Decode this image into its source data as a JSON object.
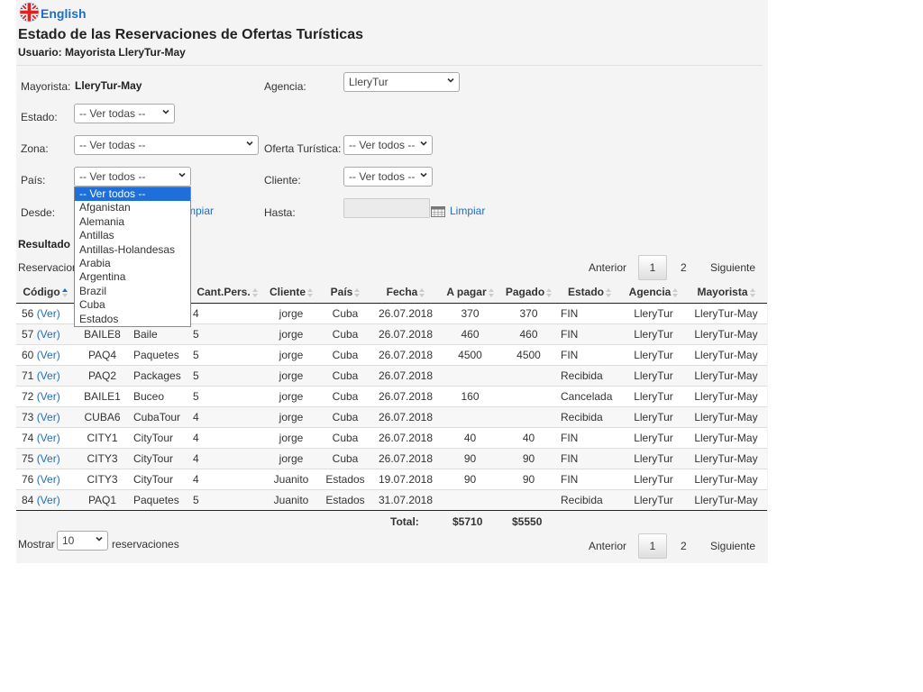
{
  "language": {
    "label": "English",
    "icon": "uk-flag-icon"
  },
  "header": {
    "title": "Estado de las Reservaciones de Ofertas Turísticas",
    "user": "Usuario: Mayorista LleryTur-May"
  },
  "filters": {
    "mayorista_label": "Mayorista:",
    "mayorista_value": "LleryTur-May",
    "agencia_label": "Agencia:",
    "agencia_value": "LleryTur",
    "estado_label": "Estado:",
    "estado_value": "-- Ver todas --",
    "zona_label": "Zona:",
    "zona_value": "-- Ver todas --",
    "oferta_label": "Oferta Turística:",
    "oferta_value": "-- Ver todos --",
    "pais_label": "País:",
    "pais_value": "-- Ver todos --",
    "cliente_label": "Cliente:",
    "cliente_value": "-- Ver todos --",
    "desde_label": "Desde:",
    "hasta_label": "Hasta:",
    "limpiar_label": "Limpiar",
    "limpiar_partial": "mpiar"
  },
  "pais_dropdown": {
    "options": [
      "-- Ver todos --",
      "Afganistan",
      "Alemania",
      "Antillas",
      "Antillas-Holandesas",
      "Arabia",
      "Argentina",
      "Brazil",
      "Cuba",
      "Estados"
    ],
    "selected_index": 0
  },
  "results": {
    "title": "Resultado",
    "subtitle": "Reservacion",
    "columns": [
      "Código",
      "",
      "",
      "Cant.Pers.",
      "Cliente",
      "País",
      "Fecha",
      "A pagar",
      "Pagado",
      "Estado",
      "Agencia",
      "Mayorista"
    ],
    "ver_label": "(Ver)",
    "rows": [
      {
        "codigo": "56",
        "code": "",
        "tipo": "",
        "cant": "4",
        "cliente": "jorge",
        "pais": "Cuba",
        "fecha": "26.07.2018",
        "apagar": "370",
        "pagado": "370",
        "estado": "FIN",
        "agencia": "LleryTur",
        "mayorista": "LleryTur-May"
      },
      {
        "codigo": "57",
        "code": "BAILE8",
        "tipo": "Baile",
        "cant": "5",
        "cliente": "jorge",
        "pais": "Cuba",
        "fecha": "26.07.2018",
        "apagar": "460",
        "pagado": "460",
        "estado": "FIN",
        "agencia": "LleryTur",
        "mayorista": "LleryTur-May"
      },
      {
        "codigo": "60",
        "code": "PAQ4",
        "tipo": "Paquetes",
        "cant": "5",
        "cliente": "jorge",
        "pais": "Cuba",
        "fecha": "26.07.2018",
        "apagar": "4500",
        "pagado": "4500",
        "estado": "FIN",
        "agencia": "LleryTur",
        "mayorista": "LleryTur-May"
      },
      {
        "codigo": "71",
        "code": "PAQ2",
        "tipo": "Packages",
        "cant": "5",
        "cliente": "jorge",
        "pais": "Cuba",
        "fecha": "26.07.2018",
        "apagar": "",
        "pagado": "",
        "estado": "Recibida",
        "agencia": "LleryTur",
        "mayorista": "LleryTur-May"
      },
      {
        "codigo": "72",
        "code": "BAILE1",
        "tipo": "Buceo",
        "cant": "5",
        "cliente": "jorge",
        "pais": "Cuba",
        "fecha": "26.07.2018",
        "apagar": "160",
        "pagado": "",
        "estado": "Cancelada",
        "agencia": "LleryTur",
        "mayorista": "LleryTur-May"
      },
      {
        "codigo": "73",
        "code": "CUBA6",
        "tipo": "CubaTour",
        "cant": "4",
        "cliente": "jorge",
        "pais": "Cuba",
        "fecha": "26.07.2018",
        "apagar": "",
        "pagado": "",
        "estado": "Recibida",
        "agencia": "LleryTur",
        "mayorista": "LleryTur-May"
      },
      {
        "codigo": "74",
        "code": "CITY1",
        "tipo": "CityTour",
        "cant": "4",
        "cliente": "jorge",
        "pais": "Cuba",
        "fecha": "26.07.2018",
        "apagar": "40",
        "pagado": "40",
        "estado": "FIN",
        "agencia": "LleryTur",
        "mayorista": "LleryTur-May"
      },
      {
        "codigo": "75",
        "code": "CITY3",
        "tipo": "CityTour",
        "cant": "4",
        "cliente": "jorge",
        "pais": "Cuba",
        "fecha": "26.07.2018",
        "apagar": "90",
        "pagado": "90",
        "estado": "FIN",
        "agencia": "LleryTur",
        "mayorista": "LleryTur-May"
      },
      {
        "codigo": "76",
        "code": "CITY3",
        "tipo": "CityTour",
        "cant": "4",
        "cliente": "Juanito",
        "pais": "Estados",
        "fecha": "19.07.2018",
        "apagar": "90",
        "pagado": "90",
        "estado": "FIN",
        "agencia": "LleryTur",
        "mayorista": "LleryTur-May"
      },
      {
        "codigo": "84",
        "code": "PAQ1",
        "tipo": "Paquetes",
        "cant": "5",
        "cliente": "Juanito",
        "pais": "Estados",
        "fecha": "31.07.2018",
        "apagar": "",
        "pagado": "",
        "estado": "Recibida",
        "agencia": "LleryTur",
        "mayorista": "LleryTur-May"
      }
    ],
    "total_label": "Total:",
    "total_apagar": "$5710",
    "total_pagado": "$5550"
  },
  "pagination": {
    "prev": "Anterior",
    "pages": [
      "1",
      "2"
    ],
    "current": "1",
    "next": "Siguiente"
  },
  "page_size": {
    "label_before": "Mostrar",
    "value": "10",
    "label_after": "reservaciones"
  }
}
